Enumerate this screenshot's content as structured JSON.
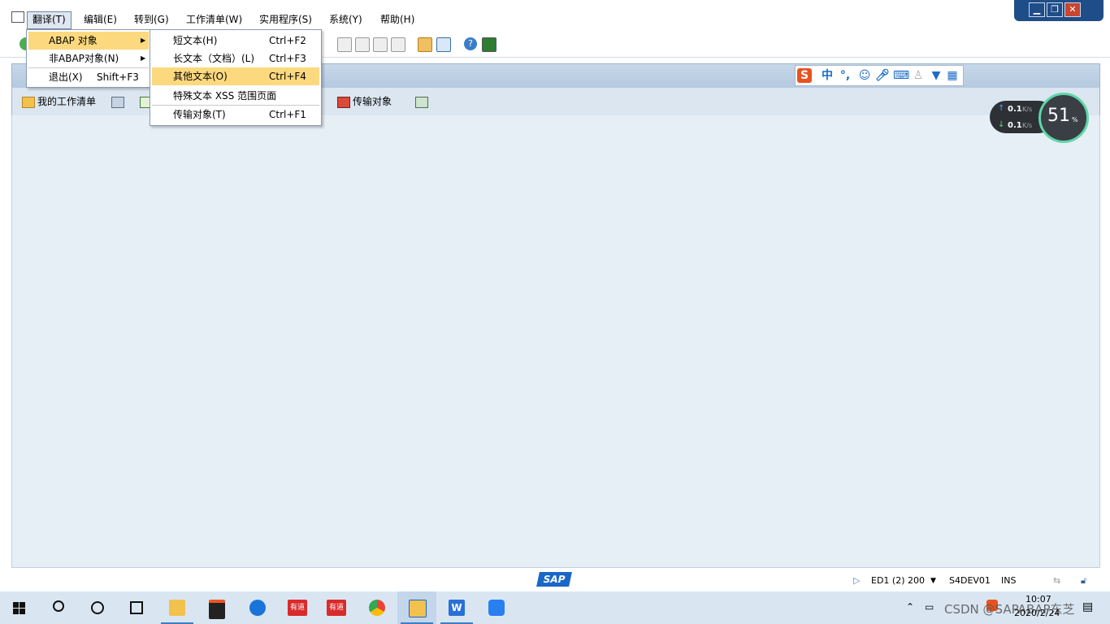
{
  "menubar": {
    "items": [
      "翻译(T)",
      "编辑(E)",
      "转到(G)",
      "工作清单(W)",
      "实用程序(S)",
      "系统(Y)",
      "帮助(H)"
    ]
  },
  "menu_translate": {
    "items": [
      {
        "label": "ABAP 对象",
        "shortcut": ""
      },
      {
        "label": "非ABAP对象(N)",
        "shortcut": ""
      },
      {
        "label": "退出(X)",
        "shortcut": "Shift+F3"
      }
    ]
  },
  "submenu_abap": {
    "items": [
      {
        "label": "短文本(H)",
        "shortcut": "Ctrl+F2"
      },
      {
        "label": "长文本（文档）(L)",
        "shortcut": "Ctrl+F3"
      },
      {
        "label": "其他文本(O)",
        "shortcut": "Ctrl+F4"
      },
      {
        "label": "特殊文本 XSS 范围页面",
        "shortcut": ""
      },
      {
        "label": "传输对象(T)",
        "shortcut": "Ctrl+F1"
      }
    ]
  },
  "app_toolbar": {
    "worklist": "我的工作清单",
    "transport": "传输对象"
  },
  "ime": {
    "mode": "中",
    "punct": "°,"
  },
  "net": {
    "up": "0.1",
    "down": "0.1",
    "unit": "K/s",
    "percent": "51",
    "percent_sign": "%"
  },
  "status": {
    "system": "ED1 (2) 200",
    "server": "S4DEV01",
    "mode": "INS",
    "sap_logo": "SAP"
  },
  "taskbar": {
    "time": "10:07",
    "date": "2020/2/24",
    "watermark": "CSDN @SAPABAP东芝",
    "youdao": "有道"
  },
  "colors": {
    "highlight": "#fcd97e",
    "content_bg": "#e6eef6",
    "taskbar_bg": "#d9e6f2"
  }
}
